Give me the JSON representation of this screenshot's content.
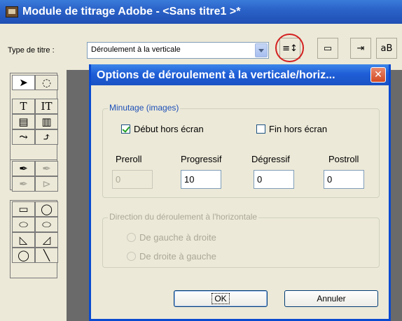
{
  "window": {
    "title": "Module de titrage Adobe - <Sans titre1 >*"
  },
  "toolbar": {
    "type_label": "Type de titre :",
    "type_value": "Déroulement à la verticale",
    "buttons": [
      {
        "icon": "roll-crawl-options-icon",
        "glyph": "≡↕"
      },
      {
        "icon": "template-icon",
        "glyph": "▭"
      },
      {
        "icon": "tab-stops-icon",
        "glyph": "⇥"
      },
      {
        "icon": "text-style-icon",
        "glyph": "aB"
      }
    ]
  },
  "palette": {
    "tools": [
      {
        "name": "selection-tool",
        "glyph": "➤"
      },
      {
        "name": "rotation-tool",
        "glyph": "◌"
      },
      {
        "name": "type-tool",
        "glyph": "T"
      },
      {
        "name": "vertical-type-tool",
        "glyph": "IT"
      },
      {
        "name": "area-type-tool",
        "glyph": "▤"
      },
      {
        "name": "vertical-area-type-tool",
        "glyph": "▥"
      },
      {
        "name": "path-type-tool",
        "glyph": "⤳"
      },
      {
        "name": "vertical-path-type-tool",
        "glyph": "⤴"
      },
      {
        "name": "pen-tool",
        "glyph": "✒"
      },
      {
        "name": "add-anchor-tool",
        "glyph": "✒"
      },
      {
        "name": "delete-anchor-tool",
        "glyph": "✒"
      },
      {
        "name": "convert-anchor-tool",
        "glyph": "⊳"
      },
      {
        "name": "rectangle-tool",
        "glyph": "▭"
      },
      {
        "name": "rounded-rect-tool",
        "glyph": "◯"
      },
      {
        "name": "clipped-rect-tool",
        "glyph": "⬭"
      },
      {
        "name": "rounded-corner-rect-tool",
        "glyph": "⬭"
      },
      {
        "name": "wedge-tool",
        "glyph": "◺"
      },
      {
        "name": "arc-tool",
        "glyph": "◿"
      },
      {
        "name": "ellipse-tool",
        "glyph": "◯"
      },
      {
        "name": "line-tool",
        "glyph": "╲"
      }
    ]
  },
  "dialog": {
    "title": "Options de déroulement à la verticale/horiz...",
    "close_glyph": "✕",
    "timing_group": "Minutage (images)",
    "start_offscreen": "Début hors écran",
    "end_offscreen": "Fin hors écran",
    "labels": {
      "preroll": "Preroll",
      "ease_in": "Progressif",
      "ease_out": "Dégressif",
      "postroll": "Postroll"
    },
    "values": {
      "preroll": "0",
      "ease_in": "10",
      "ease_out": "0",
      "postroll": "0"
    },
    "direction_group": "Direction du déroulement à l'horizontale",
    "left_to_right": "De gauche à droite",
    "right_to_left": "De droite à gauche",
    "ok": "OK",
    "cancel": "Annuler"
  },
  "colors": {
    "titlebar": "#1f5ed7",
    "highlight_ring": "#d42020",
    "group_label": "#1c4fb8"
  }
}
